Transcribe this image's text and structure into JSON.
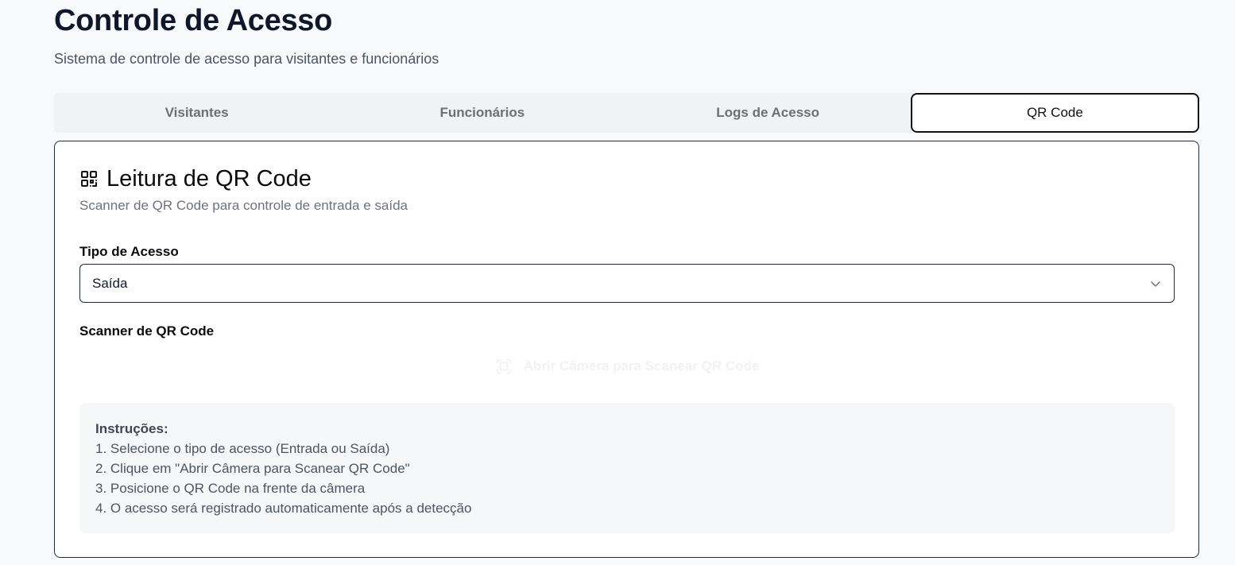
{
  "header": {
    "title": "Controle de Acesso",
    "subtitle": "Sistema de controle de acesso para visitantes e funcionários"
  },
  "tabs": [
    {
      "label": "Visitantes",
      "active": false
    },
    {
      "label": "Funcionários",
      "active": false
    },
    {
      "label": "Logs de Acesso",
      "active": false
    },
    {
      "label": "QR Code",
      "active": true
    }
  ],
  "card": {
    "icon": "qr-code-icon",
    "title": "Leitura de QR Code",
    "description": "Scanner de QR Code para controle de entrada e saída",
    "access_type": {
      "label": "Tipo de Acesso",
      "selected": "Saída"
    },
    "scanner": {
      "label": "Scanner de QR Code",
      "button_label": "Abrir Câmera para Scanear QR Code",
      "button_icon": "camera-icon"
    },
    "instructions": {
      "title": "Instruções:",
      "items": [
        "1. Selecione o tipo de acesso (Entrada ou Saída)",
        "2. Clique em \"Abrir Câmera para Scanear QR Code\"",
        "3. Posicione o QR Code na frente da câmera",
        "4. O acesso será registrado automaticamente após a detecção"
      ]
    }
  },
  "colors": {
    "background": "#f8f9fb",
    "tab_bar": "#f1f2f4",
    "border": "#1f2a44",
    "text_primary": "#0f172a",
    "text_muted": "#6b7280"
  }
}
